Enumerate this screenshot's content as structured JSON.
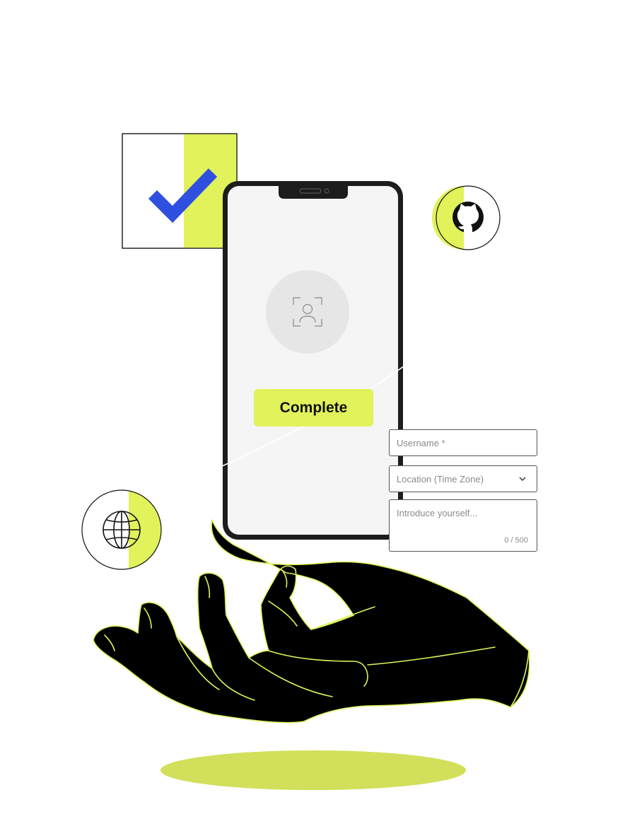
{
  "phone": {
    "complete_label": "Complete"
  },
  "form": {
    "username_placeholder": "Username *",
    "location_placeholder": "Location (Time Zone)",
    "intro_placeholder": "Introduce yourself...",
    "intro_counter": "0 / 500"
  },
  "icons": {
    "check": "check-icon",
    "github": "github-icon",
    "globe": "globe-icon",
    "face_scan": "face-scan-icon",
    "chevron": "chevron-down-icon"
  },
  "colors": {
    "accent_lime": "#e1f25a",
    "shadow_lime": "#d2df5a",
    "check_blue": "#2f4fe0",
    "phone_frame": "#1d1d1d",
    "screen": "#f4f5f4",
    "hand": "#000000"
  }
}
